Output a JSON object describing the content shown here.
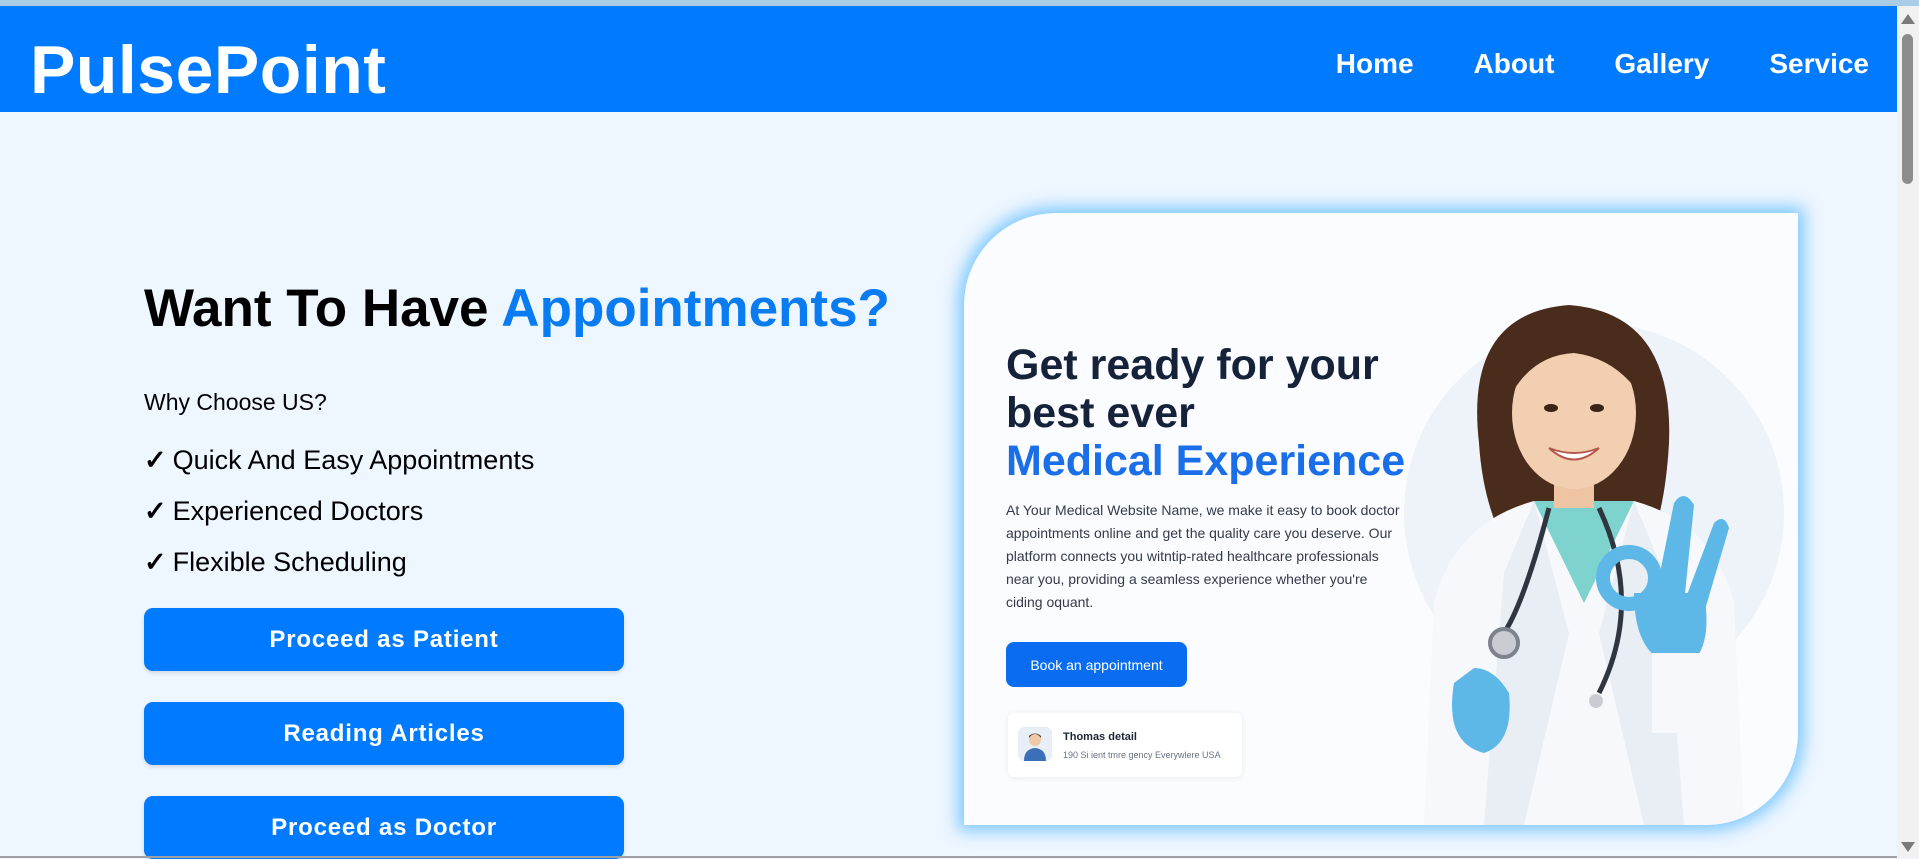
{
  "header": {
    "brand": "PulsePoint",
    "nav": [
      "Home",
      "About",
      "Gallery",
      "Service"
    ]
  },
  "hero": {
    "title_prefix": "Want To Have ",
    "title_accent": "Appointments?",
    "why": "Why Choose US?",
    "check_symbol": "✓",
    "features": [
      "Quick And Easy Appointments",
      "Experienced Doctors",
      "Flexible Scheduling"
    ],
    "buttons": [
      "Proceed as Patient",
      "Reading Articles",
      "Proceed as Doctor"
    ]
  },
  "promo": {
    "title_line1": "Get ready for your",
    "title_line2": "best ever",
    "title_line3": "Medical Experience",
    "body": "At Your Medical Website Name, we make it easy to book doctor appointments online and get the quality care you deserve. Our platform connects you witntip-rated healthcare professionals near you, providing a seamless experience whether you're ciding oquant.",
    "cta": "Book an appointment",
    "review_name": "Thomas detail",
    "review_meta": "190 Si ient tmre gency   Everywlere USA"
  },
  "colors": {
    "primary": "#007bff",
    "accent_text": "#0a7cf2",
    "background": "#eef6ff",
    "glove": "#5db8e8"
  }
}
